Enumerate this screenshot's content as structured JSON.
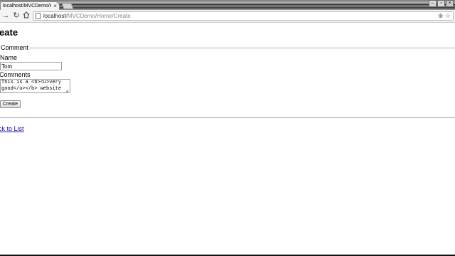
{
  "browser": {
    "tab": {
      "title": "localhost/MVCDemo/Hom",
      "close": "×"
    },
    "nav": {
      "back": "←",
      "forward": "→",
      "reload": "↻"
    },
    "address": {
      "host": "localhost",
      "path": "/MVCDemo/Home/Create",
      "zoom_glyph": "⊕",
      "star_glyph": "☆"
    },
    "window": {
      "minimize": "–",
      "restore": "▫",
      "close": "×"
    }
  },
  "page": {
    "title": "reate",
    "fieldset_legend": "Comment",
    "name_label": "Name",
    "name_value": "Tom",
    "comments_label": "Comments",
    "comments_value": "This is a <b><u>very\ngood</u></b> website",
    "create_button": "Create",
    "back_link": "ack to List"
  },
  "colors": {
    "link": "#1a0dab",
    "url_path": "#8a8a8a",
    "toolbar_bg": "#f4f4f4"
  }
}
